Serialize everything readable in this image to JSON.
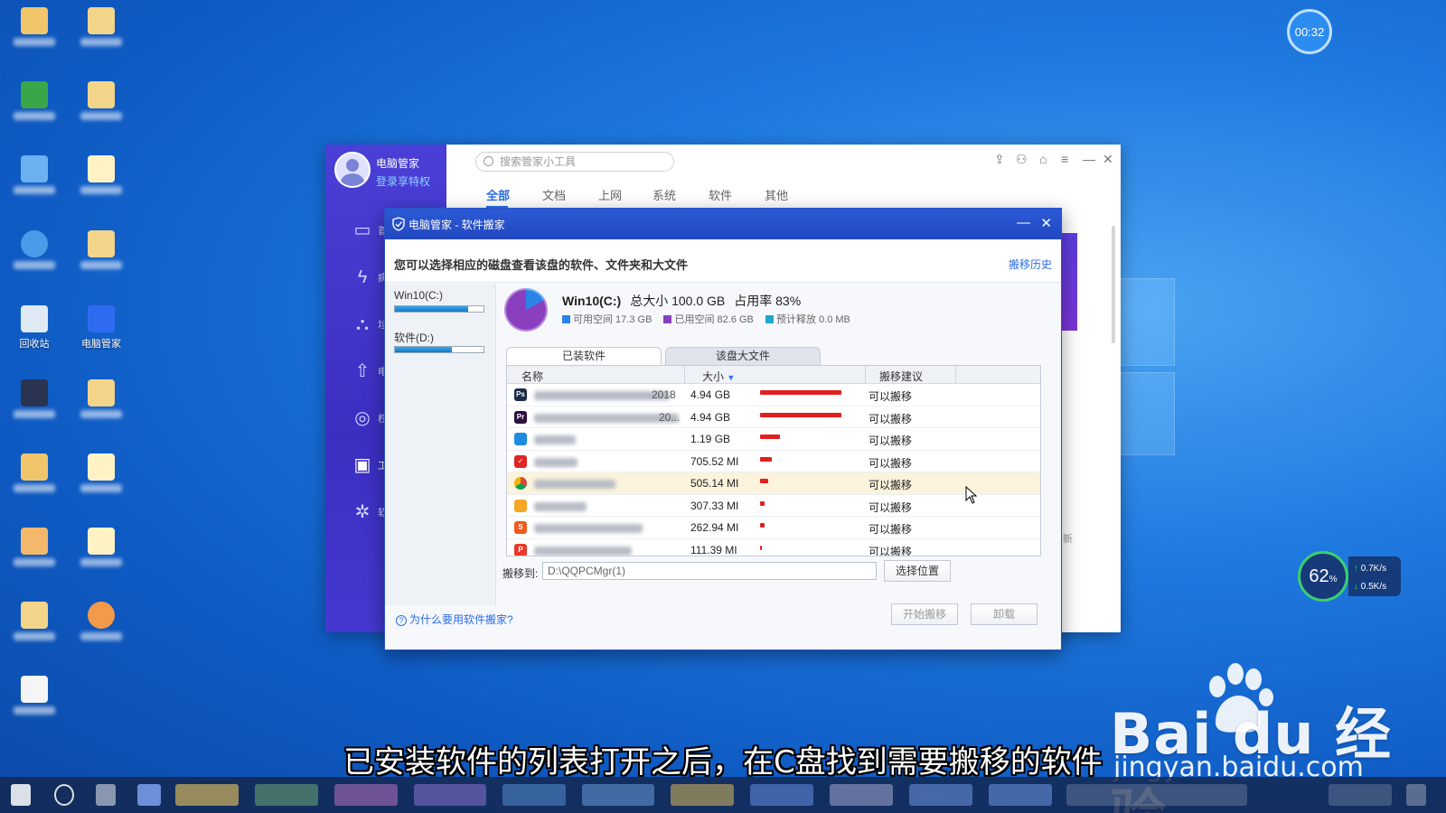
{
  "timer": "00:32",
  "main_window": {
    "app_name": "电脑管家",
    "login_text": "登录享特权",
    "search_placeholder": "搜索管家小工具",
    "category_tabs": [
      "全部",
      "文档",
      "上网",
      "系统",
      "软件",
      "其他"
    ],
    "side_labels": [
      "首",
      "病",
      "垃",
      "电",
      "权",
      "工",
      "软"
    ],
    "right_partial": [
      "新",
      "況"
    ]
  },
  "dialog": {
    "title": "电脑管家 - 软件搬家",
    "hint": "您可以选择相应的磁盘查看该盘的软件、文件夹和大文件",
    "history": "搬移历史",
    "disks": [
      {
        "name": "Win10(C:)",
        "usage": 0.83
      },
      {
        "name": "软件(D:)",
        "usage": 0.64
      }
    ],
    "drive": {
      "name": "Win10(C:)",
      "total": "总大小 100.0 GB",
      "usage": "占用率 83%",
      "free": "可用空间 17.3 GB",
      "used": "已用空间 82.6 GB",
      "release": "预计释放 0.0 MB",
      "colors": {
        "free": "#2a84e8",
        "used": "#8a3fbf",
        "release": "#1fa6c9"
      }
    },
    "tabs": [
      "已装软件",
      "该盘大文件"
    ],
    "table": {
      "headers": {
        "name": "名称",
        "size": "大小",
        "advice": "搬移建议"
      },
      "rows": [
        {
          "icon": "photoshop-icon",
          "color": "#1b2a4a",
          "glyph": "Ps",
          "suffix": "2018",
          "size": "4.94 GB",
          "ratio": 1.0,
          "advice": "可以搬移"
        },
        {
          "icon": "premiere-icon",
          "color": "#2a1040",
          "glyph": "Pr",
          "suffix": "20...",
          "size": "4.94 GB",
          "ratio": 1.0,
          "advice": "可以搬移"
        },
        {
          "icon": "app-blue-icon",
          "color": "#1e8be0",
          "glyph": "",
          "suffix": "",
          "size": "1.19 GB",
          "ratio": 0.24,
          "advice": "可以搬移"
        },
        {
          "icon": "app-red-icon",
          "color": "#e02424",
          "glyph": "✓",
          "suffix": "",
          "size": "705.52 MI",
          "ratio": 0.14,
          "advice": "可以搬移"
        },
        {
          "icon": "chrome-icon",
          "color": "#ffffff",
          "glyph": "",
          "suffix": "",
          "size": "505.14 MI",
          "ratio": 0.1,
          "advice": "可以搬移"
        },
        {
          "icon": "app-orange-icon",
          "color": "#f5a623",
          "glyph": "",
          "suffix": "",
          "size": "307.33 MI",
          "ratio": 0.06,
          "advice": "可以搬移"
        },
        {
          "icon": "app-s-icon",
          "color": "#f25a1d",
          "glyph": "S",
          "suffix": "",
          "size": "262.94 MI",
          "ratio": 0.05,
          "advice": "可以搬移"
        },
        {
          "icon": "pdf-icon",
          "color": "#e63a2e",
          "glyph": "P",
          "suffix": "",
          "size": "111.39 MI",
          "ratio": 0.02,
          "advice": "可以搬移"
        }
      ]
    },
    "move_to_label": "搬移到:",
    "move_to_path": "D:\\QQPCMgr(1)",
    "choose_button": "选择位置",
    "start_button": "开始搬移",
    "uninstall_button": "卸载",
    "help_link": "为什么要用软件搬家?"
  },
  "desktop_icons": [
    {
      "label": "回收站"
    },
    {
      "label": "电脑管家"
    }
  ],
  "net_widget": {
    "percent": "62",
    "percent_unit": "%",
    "up": "0.7K/s",
    "down": "0.5K/s"
  },
  "watermark": {
    "logo_text": "Bai du 经验",
    "url": "jingyan.baidu.com"
  },
  "subtitle": "已安装软件的列表打开之后，在C盘找到需要搬移的软件"
}
